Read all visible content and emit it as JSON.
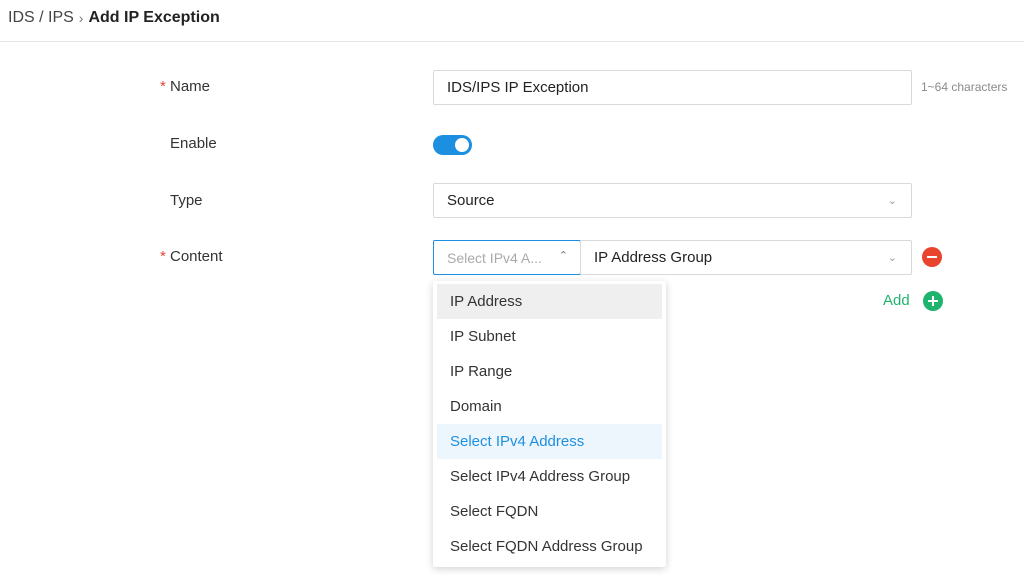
{
  "breadcrumb": {
    "parent": "IDS / IPS",
    "separator": "›",
    "current": "Add IP Exception"
  },
  "form": {
    "name": {
      "label": "Name",
      "required": "*",
      "value": "IDS/IPS IP Exception",
      "hint": "1~64 characters"
    },
    "enable": {
      "label": "Enable",
      "on": true
    },
    "type": {
      "label": "Type",
      "value": "Source"
    },
    "content": {
      "label": "Content",
      "required": "*",
      "kind_placeholder": "Select IPv4 A...",
      "group_value": "IP Address Group"
    },
    "add_label": "Add"
  },
  "dropdown": {
    "options": [
      "IP Address",
      "IP Subnet",
      "IP Range",
      "Domain",
      "Select IPv4 Address",
      "Select IPv4 Address Group",
      "Select FQDN",
      "Select FQDN Address Group"
    ],
    "hovered": "IP Address",
    "selected": "Select IPv4 Address"
  },
  "colors": {
    "accent": "#1d8fe1",
    "danger": "#e8442e",
    "success": "#1fb46e"
  },
  "icons": {
    "chevron": "chevron-down-icon",
    "remove": "minus-circle-icon",
    "add": "plus-circle-icon"
  }
}
